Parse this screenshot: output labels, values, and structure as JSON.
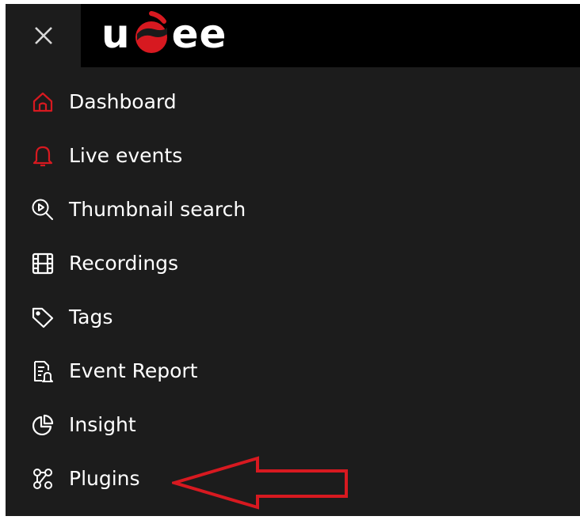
{
  "header": {
    "close_glyph": "×",
    "logo": {
      "letters_left": "u",
      "letters_right": "ee",
      "accent_color": "#d71920"
    }
  },
  "nav": {
    "items": [
      {
        "label": "Dashboard",
        "icon": "home-icon",
        "icon_color": "#d71920"
      },
      {
        "label": "Live events",
        "icon": "bell-icon",
        "icon_color": "#d71920"
      },
      {
        "label": "Thumbnail search",
        "icon": "search-play-icon",
        "icon_color": "#ffffff"
      },
      {
        "label": "Recordings",
        "icon": "film-icon",
        "icon_color": "#ffffff"
      },
      {
        "label": "Tags",
        "icon": "tag-icon",
        "icon_color": "#ffffff"
      },
      {
        "label": "Event Report",
        "icon": "report-icon",
        "icon_color": "#ffffff"
      },
      {
        "label": "Insight",
        "icon": "pie-chart-icon",
        "icon_color": "#ffffff"
      },
      {
        "label": "Plugins",
        "icon": "plugins-icon",
        "icon_color": "#ffffff"
      }
    ]
  },
  "annotation": {
    "arrow_color": "#d71920",
    "points_to": "Plugins"
  }
}
